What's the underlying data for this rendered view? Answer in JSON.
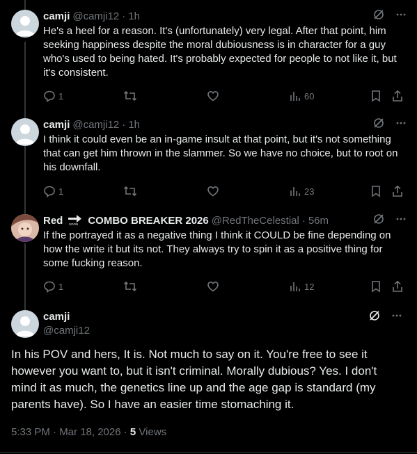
{
  "replies": [
    {
      "name": "camji",
      "handle": "@camji12",
      "time": "1h",
      "text": "He's a heel for a reason. It's (unfortunately) very legal. After that point, him seeking happiness despite the moral dubiousness is in character for a guy who's used to being hated. It's probably expected for people to not like it, but it's consistent.",
      "reply_count": "1",
      "views": "60"
    },
    {
      "name": "camji",
      "handle": "@camji12",
      "time": "1h",
      "text": "I think it could even be an in-game insult at that point, but it's not something that can get him thrown in the slammer. So we have no choice, but to root on his downfall.",
      "reply_count": "1",
      "views": "23"
    },
    {
      "name": "Red",
      "name_suffix": "COMBO BREAKER 2026",
      "badge_text": "SOON",
      "handle": "@RedTheCelestial",
      "time": "56m",
      "text": "If the portrayed it as a negative thing I think it COULD be  fine depending on how the write it but its not. They always try to spin it as a positive thing for some fucking reason.",
      "reply_count": "1",
      "views": "12"
    }
  ],
  "main": {
    "name": "camji",
    "handle": "@camji12",
    "text": "In his POV and hers, It is. Not much to say on it. You're free to see it however you want to, but it isn't criminal. Morally dubious? Yes. I don't mind it as much, the genetics line up and the age gap is standard (my parents have). So I have an easier time stomaching it.",
    "timestamp": "5:33 PM · Mar 18, 2026 · ",
    "views_count": "5",
    "views_label": " Views"
  },
  "colors": {
    "background": "#000000",
    "text": "#e7e9ea",
    "muted": "#71767b",
    "border": "#2f3336"
  }
}
